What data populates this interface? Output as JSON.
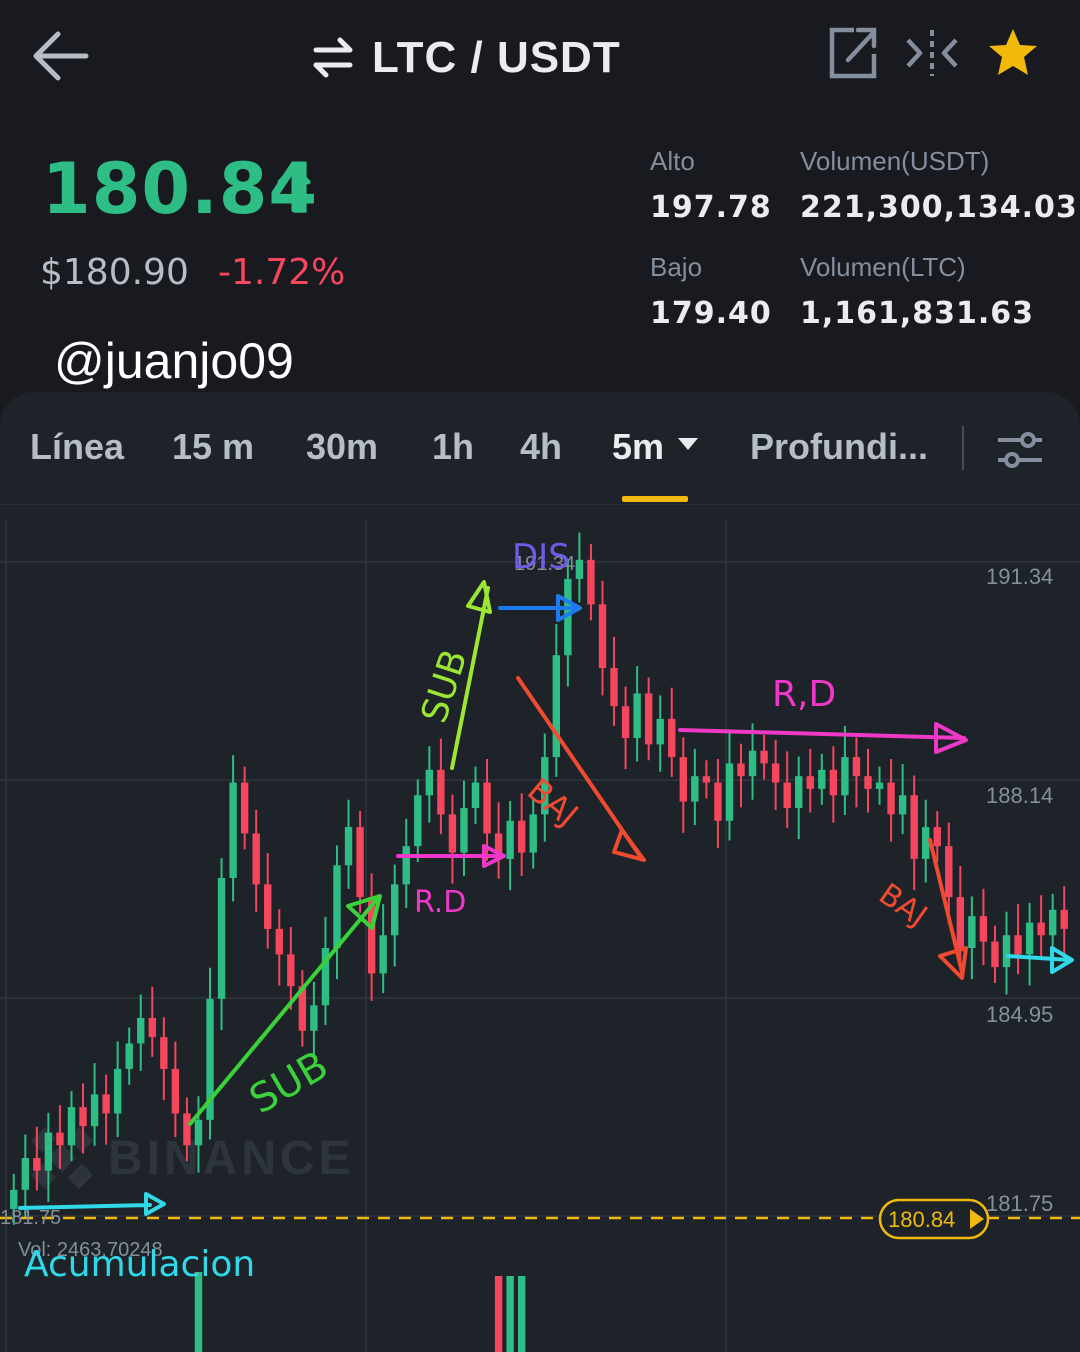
{
  "header": {
    "pair": "LTC / USDT",
    "back_icon": "arrow-left-icon",
    "swap_icon": "swap-arrows-icon",
    "icons": [
      "expand-icon",
      "compare-icon",
      "star-icon"
    ],
    "favorite_color": "#f0b90b"
  },
  "ticker": {
    "last_price": "180.84",
    "usd_price": "$180.90",
    "change_pct": "-1.72%",
    "high_label": "Alto",
    "high_value": "197.78",
    "low_label": "Bajo",
    "low_value": "179.40",
    "vol_usdt_label": "Volumen(USDT)",
    "vol_usdt_value": "221,300,134.03",
    "vol_ltc_label": "Volumen(LTC)",
    "vol_ltc_value": "1,161,831.63",
    "up_color": "#2ebd85",
    "down_color": "#f6465d"
  },
  "watermark_user": "@juanjo09",
  "tabs": [
    {
      "label": "Línea",
      "active": false
    },
    {
      "label": "15 m",
      "active": false
    },
    {
      "label": "30m",
      "active": false
    },
    {
      "label": "1h",
      "active": false
    },
    {
      "label": "4h",
      "active": false
    },
    {
      "label": "5m",
      "active": true
    },
    {
      "label": "Profundi...",
      "active": false
    }
  ],
  "chart_data": {
    "type": "candlestick",
    "y_ticks": [
      "191.34",
      "188.14",
      "184.95",
      "181.75"
    ],
    "ylim": [
      181.0,
      192.0
    ],
    "left_label": "181.75",
    "current_price_tag": "180.84",
    "volume_label": "Vol: 2463.70248",
    "brand_watermark": "BINANCE",
    "peak_label": "191.34",
    "annotations": [
      "SUB",
      "SUB",
      "R.D",
      "DIS",
      "BAJ",
      "R,D",
      "BAJ",
      "Acumulacion"
    ],
    "candles_close": [
      181.6,
      182.1,
      181.9,
      182.5,
      182.3,
      182.9,
      182.6,
      183.1,
      182.8,
      183.5,
      183.9,
      184.3,
      184.0,
      183.5,
      182.8,
      182.3,
      182.7,
      184.6,
      186.5,
      188.0,
      187.2,
      186.4,
      185.7,
      185.3,
      184.8,
      184.1,
      184.5,
      185.4,
      186.7,
      187.3,
      186.2,
      185.0,
      185.6,
      186.4,
      187.0,
      187.8,
      188.2,
      187.5,
      186.9,
      187.6,
      188.0,
      187.2,
      186.8,
      187.4,
      186.9,
      187.5,
      188.4,
      190.0,
      191.2,
      191.5,
      190.8,
      189.8,
      189.2,
      188.7,
      189.4,
      188.6,
      189.0,
      188.4,
      187.7,
      188.1,
      188.0,
      187.4,
      188.3,
      188.1,
      188.5,
      188.3,
      188.0,
      187.6,
      188.1,
      187.9,
      188.2,
      187.8,
      188.4,
      188.1,
      187.9,
      188.0,
      187.5,
      187.8,
      186.8,
      187.3,
      187.0,
      186.2,
      185.4,
      185.9,
      185.5,
      185.1,
      185.6,
      185.3,
      185.8,
      185.6,
      186.0,
      185.7
    ]
  }
}
